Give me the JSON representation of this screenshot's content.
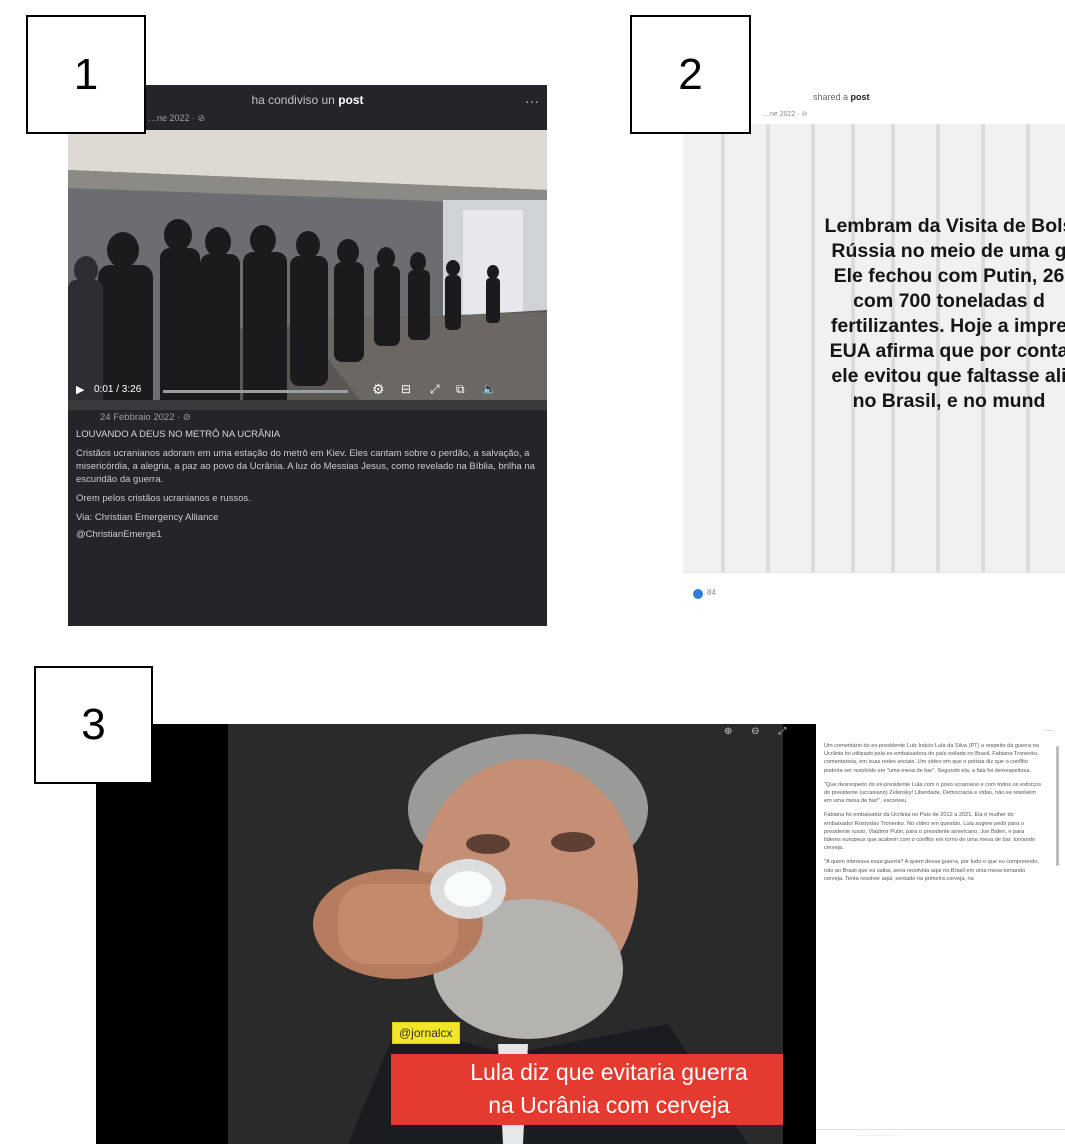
{
  "labels": {
    "n1": "1",
    "n2": "2",
    "n3": "3"
  },
  "panel1": {
    "header_prefix": "ha condiviso un",
    "header_bold": "post",
    "header_date": "…ne 2022 · ⊘",
    "more_label": "···",
    "video_time": "0:01 / 3:26",
    "post_date": "24 Febbraio 2022 · ⊘",
    "post_title": "LOUVANDO A DEUS NO METRÔ NA UCRÂNIA",
    "post_body": "Cristãos ucranianos adoram em uma estação do metrô em Kiev. Eles cantam sobre o perdão, a salvação, a misericórdia, a alegria, a paz ao povo da Ucrânia. A luz do Messias Jesus, como revelado na Bíblia, brilha na escuridão da guerra.",
    "post_line2": "Orem pelos cristãos ucranianos e russos.",
    "post_via": "Via: Christian Emergency Alliance",
    "post_handle": "@ChristianEmerge1",
    "colors": {
      "bg": "#232529",
      "text": "#c9ccd1"
    }
  },
  "panel2": {
    "header_prefix": "shared a",
    "header_bold": "post",
    "header_date": "…ne 2022 · ⊘",
    "lines": [
      "Lembram da Visita de Bols",
      "Rússia  no meio de uma g",
      "Ele fechou com Putin, 26",
      "com 700 toneladas d",
      "fertilizantes. Hoje a impre",
      "EUA afirma que por conta",
      "ele evitou que  faltasse ali",
      "no Brasil, e no mund"
    ],
    "reaction_count": "84"
  },
  "panel3": {
    "handle": "@jornalcx",
    "banner_line1": "Lula diz que evitaria guerra",
    "banner_line2": "na Ucrânia com cerveja",
    "zoom_icons": "⊕ ⊖ ⤢",
    "more_label": "···",
    "side_p1": "Um comentário do ex-presidente Luiz Inácio Lula da Silva (PT) a respeito da guerra na Ucrânia foi utilizado pela ex-embaixadora do país exilada no Brasil, Fabiana Tronenko, comentarista, em suas redes sociais. Um vídeo em que o petista diz que o conflito poderia ser resolvido em \"uma mesa de bar\". Segundo ela, a fala foi desrespeitosa.",
    "side_p2": "\"Que desrespeito do ex-presidente Lula com o povo ucraniano e com todos os esforços do presidente (ucraniano) Zelensky! Liberdade, Democracia e vidas, não se resolvem em uma mesa de bar!\", escreveu.",
    "side_p3": "Fabiana foi embaixatriz da Ucrânia no País de 2012 a 2021. Ela é mulher do embaixador Rostyslav Tronenko. No vídeo em questão, Lula sugere pedir para o presidente russo, Vladimir Putin, para o presidente americano, Joe Biden, e para líderes europeus que acabem com o conflito em torno de uma mesa de bar, tomando cerveja.",
    "side_p4": "\"A quem interessa essa guerra? A quem dessa guerra, por tudo o que eu compreendo, não ao Brasil que eu saiba, seria resolvida aqui no Brasil em uma mesa tomando cerveja. Tenta resolver aqui, sentado na primeira cerveja, na",
    "side_bottom": "· · · · · · · · · · · · · ·"
  }
}
